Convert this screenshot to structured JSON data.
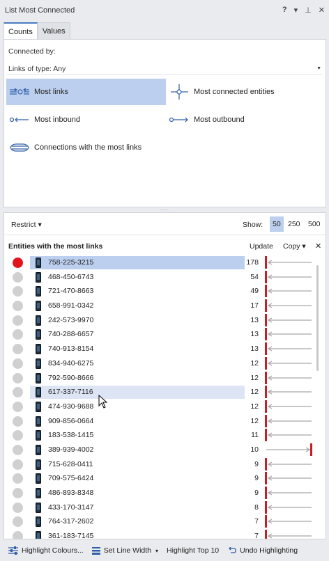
{
  "window": {
    "title": "List Most Connected",
    "help": "?",
    "menu": "▾",
    "pin": "⊥",
    "close": "✕"
  },
  "tabs": [
    {
      "label": "Counts",
      "active": true
    },
    {
      "label": "Values",
      "active": false
    }
  ],
  "connected_by": {
    "label": "Connected by:",
    "links_type": "Links of type: Any",
    "dropdown_icon": "▼"
  },
  "options": {
    "most_links": "Most links",
    "most_connected": "Most connected entities",
    "most_inbound": "Most inbound",
    "most_outbound": "Most outbound",
    "connections": "Connections with the most links"
  },
  "splitter_grip": "......",
  "filter": {
    "restrict": "Restrict ▾",
    "show_label": "Show:",
    "show_options": [
      "50",
      "250",
      "500"
    ],
    "show_active": "50"
  },
  "list": {
    "title": "Entities with the most links",
    "update": "Update",
    "copy": "Copy ▾",
    "close": "✕",
    "rows": [
      {
        "number": "758-225-3215",
        "count": "178",
        "direction": "in"
      },
      {
        "number": "468-450-6743",
        "count": "54",
        "direction": "in"
      },
      {
        "number": "721-470-8663",
        "count": "49",
        "direction": "in"
      },
      {
        "number": "658-991-0342",
        "count": "17",
        "direction": "in"
      },
      {
        "number": "242-573-9970",
        "count": "13",
        "direction": "in"
      },
      {
        "number": "740-288-6657",
        "count": "13",
        "direction": "in"
      },
      {
        "number": "740-913-8154",
        "count": "13",
        "direction": "in"
      },
      {
        "number": "834-940-6275",
        "count": "12",
        "direction": "in"
      },
      {
        "number": "792-590-8666",
        "count": "12",
        "direction": "in"
      },
      {
        "number": "617-337-7116",
        "count": "12",
        "direction": "in"
      },
      {
        "number": "474-930-9688",
        "count": "12",
        "direction": "in"
      },
      {
        "number": "909-856-0664",
        "count": "12",
        "direction": "in"
      },
      {
        "number": "183-538-1415",
        "count": "11",
        "direction": "in"
      },
      {
        "number": "389-939-4002",
        "count": "10",
        "direction": "out"
      },
      {
        "number": "715-628-0411",
        "count": "9",
        "direction": "in"
      },
      {
        "number": "709-575-6424",
        "count": "9",
        "direction": "in"
      },
      {
        "number": "486-893-8348",
        "count": "9",
        "direction": "in"
      },
      {
        "number": "433-170-3147",
        "count": "8",
        "direction": "in"
      },
      {
        "number": "764-317-2602",
        "count": "7",
        "direction": "in"
      },
      {
        "number": "361-183-7145",
        "count": "7",
        "direction": "in"
      }
    ],
    "selected_index": 0,
    "hover_index": 9
  },
  "toolbar": {
    "highlight_colours": "Highlight Colours...",
    "set_line_width": "Set Line Width",
    "set_line_width_arrow": "▾",
    "highlight_top": "Highlight Top 10",
    "undo": "Undo Highlighting"
  },
  "colors": {
    "selection": "#bccfee",
    "hover": "#dde5f5",
    "accent_red": "#e3141c",
    "icon_blue": "#2f5ea8"
  }
}
